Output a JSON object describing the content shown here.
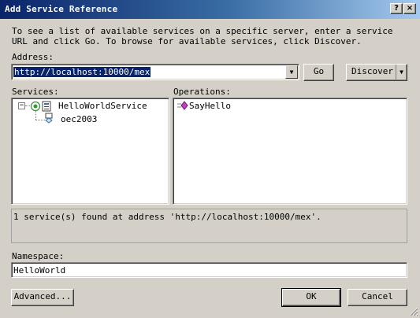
{
  "window": {
    "title": "Add Service Reference",
    "help_button": "?",
    "close_button": "×"
  },
  "description": "To see a list of available services on a specific server, enter a service URL and click Go. To browse for available services, click Discover.",
  "address": {
    "label": "Address:",
    "value": "http://localhost:10000/mex"
  },
  "buttons": {
    "go": "Go",
    "discover": "Discover",
    "advanced": "Advanced...",
    "ok": "OK",
    "cancel": "Cancel"
  },
  "services": {
    "label": "Services:",
    "items": [
      {
        "label": "HelloWorldService",
        "children": [
          {
            "label": "oec2003"
          }
        ]
      }
    ]
  },
  "operations": {
    "label": "Operations:",
    "items": [
      {
        "label": "SayHello"
      }
    ]
  },
  "status": "1 service(s) found at address 'http://localhost:10000/mex'.",
  "namespace": {
    "label": "Namespace:",
    "value": "HelloWorld"
  },
  "icons": {
    "expand": "minus-box-icon",
    "service": "service-icon",
    "contract": "contract-icon",
    "operation": "method-icon"
  }
}
